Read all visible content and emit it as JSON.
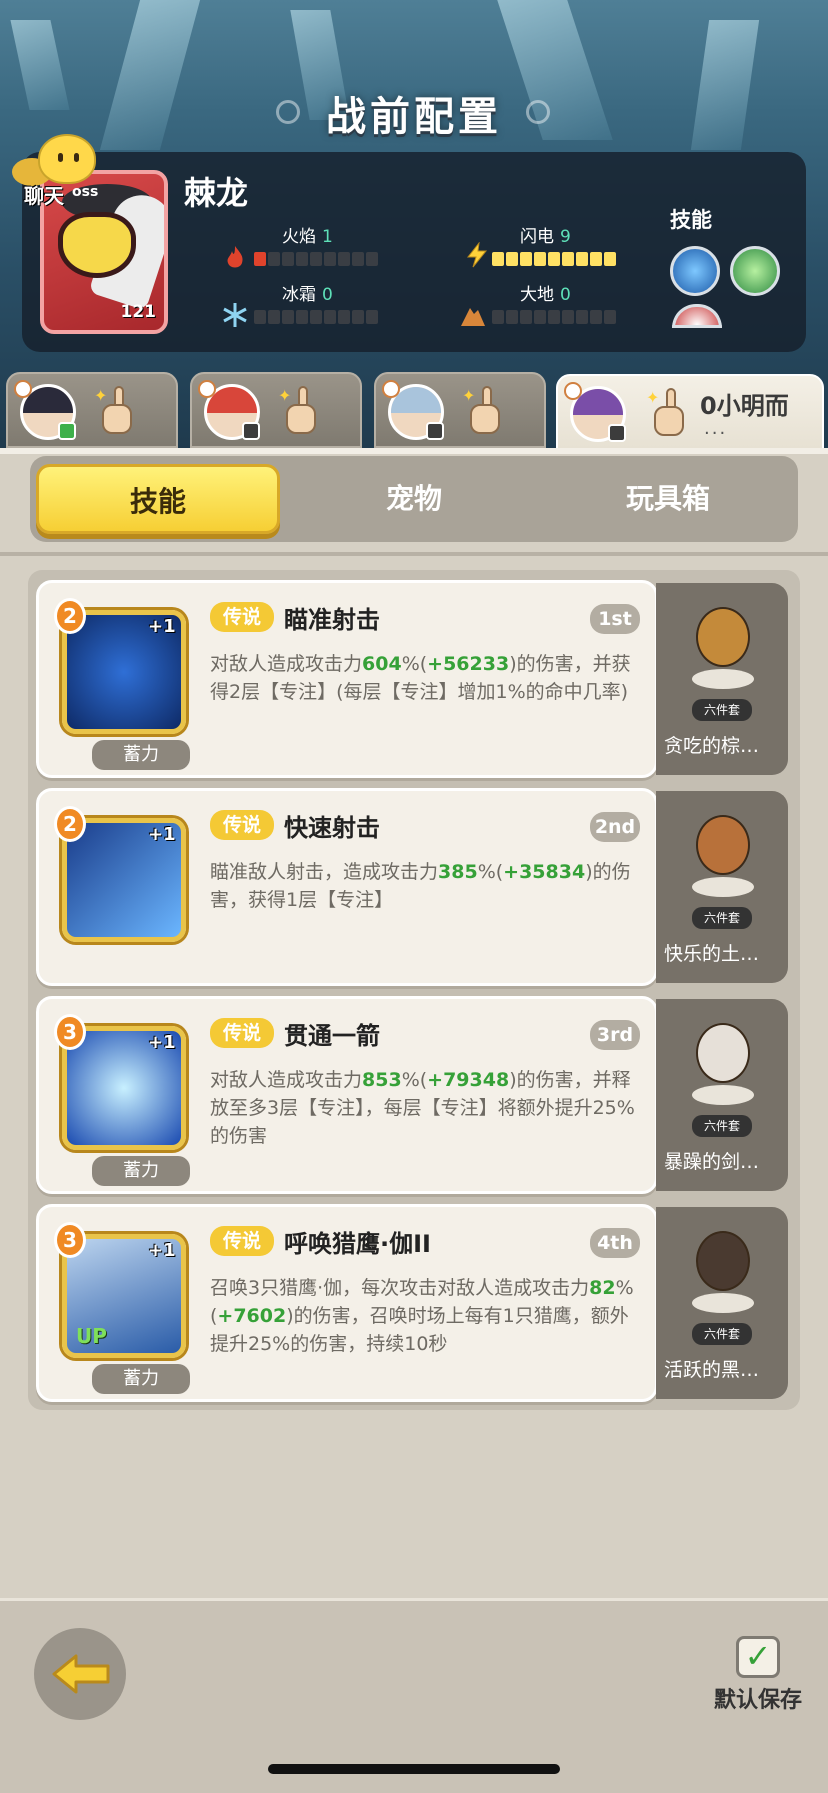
{
  "header": {
    "title": "战前配置",
    "chat_label": "聊天",
    "boss": {
      "tag": "oss",
      "name": "棘龙",
      "level": "121",
      "elements": [
        {
          "name": "火焰",
          "value": "1",
          "icon": "fire-icon",
          "filled": 1
        },
        {
          "name": "闪电",
          "value": "9",
          "icon": "lightning-icon",
          "filled": 9
        },
        {
          "name": "冰霜",
          "value": "0",
          "icon": "snowflake-icon",
          "filled": 0
        },
        {
          "name": "大地",
          "value": "0",
          "icon": "earth-icon",
          "filled": 0
        }
      ],
      "skills_label": "技能",
      "skill_icons": [
        "blue-orb-skill-icon",
        "green-orb-skill-icon",
        "eye-skill-icon"
      ]
    }
  },
  "team_tabs": [
    {
      "avatar": "dark-hair-hero-avatar",
      "badge": "green"
    },
    {
      "avatar": "red-hair-hero-avatar",
      "badge": "dark"
    },
    {
      "avatar": "silver-hair-hero-avatar",
      "badge": "dark"
    },
    {
      "avatar": "purple-hair-hero-avatar",
      "badge": "dark",
      "name": "0小明而",
      "sub": "..."
    }
  ],
  "tabs": [
    {
      "label": "技能",
      "active": true
    },
    {
      "label": "宠物",
      "active": false
    },
    {
      "label": "玩具箱",
      "active": false
    }
  ],
  "skills": [
    {
      "level": "2",
      "plus": "+1",
      "rarity": "传说",
      "name": "瞄准射击",
      "order": "1st",
      "charge": "蓄力",
      "desc": [
        {
          "t": "对敌人造成攻击力"
        },
        {
          "t": "604",
          "g": true
        },
        {
          "t": "%("
        },
        {
          "t": "+56233",
          "g": true
        },
        {
          "t": ")的伤害，并获得2层【专注】(每层【专注】增加1%的命中几率)"
        }
      ],
      "icon": "crosshair-skill-icon",
      "pet": {
        "set": "六件套",
        "name": "贪吃的棕…",
        "figure": "bee-bear-pet-icon"
      }
    },
    {
      "level": "2",
      "plus": "+1",
      "rarity": "传说",
      "name": "快速射击",
      "order": "2nd",
      "charge": "",
      "desc": [
        {
          "t": "瞄准敌人射击，造成攻击力"
        },
        {
          "t": "385",
          "g": true
        },
        {
          "t": "%("
        },
        {
          "t": "+35834",
          "g": true
        },
        {
          "t": ")的伤害，获得1层【专注】"
        }
      ],
      "icon": "arrow-shot-skill-icon",
      "pet": {
        "set": "六件套",
        "name": "快乐的土…",
        "figure": "leaf-pup-pet-icon"
      }
    },
    {
      "level": "3",
      "plus": "+1",
      "rarity": "传说",
      "name": "贯通一箭",
      "order": "3rd",
      "charge": "蓄力",
      "desc": [
        {
          "t": "对敌人造成攻击力"
        },
        {
          "t": "853",
          "g": true
        },
        {
          "t": "%("
        },
        {
          "t": "+79348",
          "g": true
        },
        {
          "t": ")的伤害，并释放至多3层【专注】，每层【专注】将额外提升25%的伤害"
        }
      ],
      "icon": "piercing-arrow-skill-icon",
      "pet": {
        "set": "六件套",
        "name": "暴躁的剑…",
        "figure": "swordsman-cat-pet-icon"
      }
    },
    {
      "level": "3",
      "plus": "+1",
      "rarity": "传说",
      "name": "呼唤猎鹰·伽II",
      "order": "4th",
      "charge": "蓄力",
      "up": "UP",
      "desc": [
        {
          "t": "召唤3只猎鹰·伽，每次攻击对敌人造成攻击力"
        },
        {
          "t": "82",
          "g": true
        },
        {
          "t": "%("
        },
        {
          "t": "+7602",
          "g": true
        },
        {
          "t": ")的伤害，召唤时场上每有1只猎鹰，额外提升25%的伤害，持续10秒"
        }
      ],
      "icon": "falcon-skill-icon",
      "pet": {
        "set": "六件套",
        "name": "活跃的黑…",
        "figure": "black-boar-pet-icon"
      }
    }
  ],
  "footer": {
    "save_label": "默认保存",
    "save_checked": true
  },
  "colors": {
    "accent_yellow": "#f6cf34",
    "highlight_green": "#36a138",
    "rarity_gold": "#f4c935"
  }
}
